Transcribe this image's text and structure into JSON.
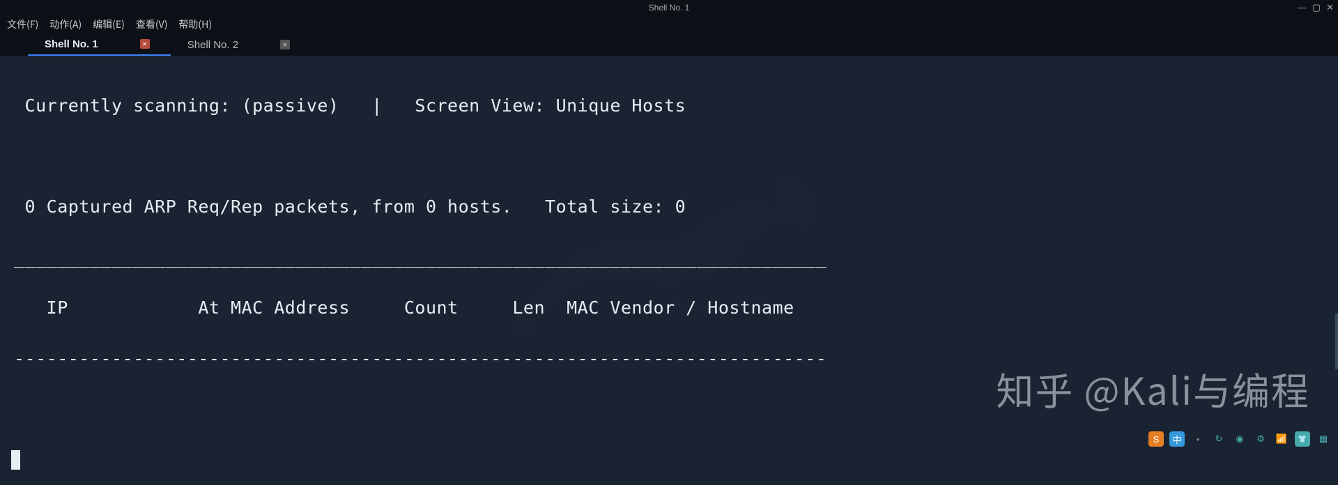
{
  "window": {
    "title": "Shell No. 1"
  },
  "menu": {
    "file": "文件(F)",
    "action": "动作(A)",
    "edit": "编辑(E)",
    "view": "查看(V)",
    "help": "帮助(H)"
  },
  "tabs": [
    {
      "label": "Shell No. 1",
      "active": true
    },
    {
      "label": "Shell No. 2",
      "active": false
    }
  ],
  "term": {
    "line1": " Currently scanning: (passive)   |   Screen View: Unique Hosts",
    "blank": " ",
    "line2": " 0 Captured ARP Req/Rep packets, from 0 hosts.   Total size: 0",
    "rule": " ___________________________________________________________________________",
    "head": "   IP            At MAC Address     Count     Len  MAC Vendor / Hostname",
    "rule2": " ---------------------------------------------------------------------------"
  },
  "watermark": "知乎 @Kali与编程",
  "tray": {
    "ime": "中",
    "dot": "•"
  }
}
